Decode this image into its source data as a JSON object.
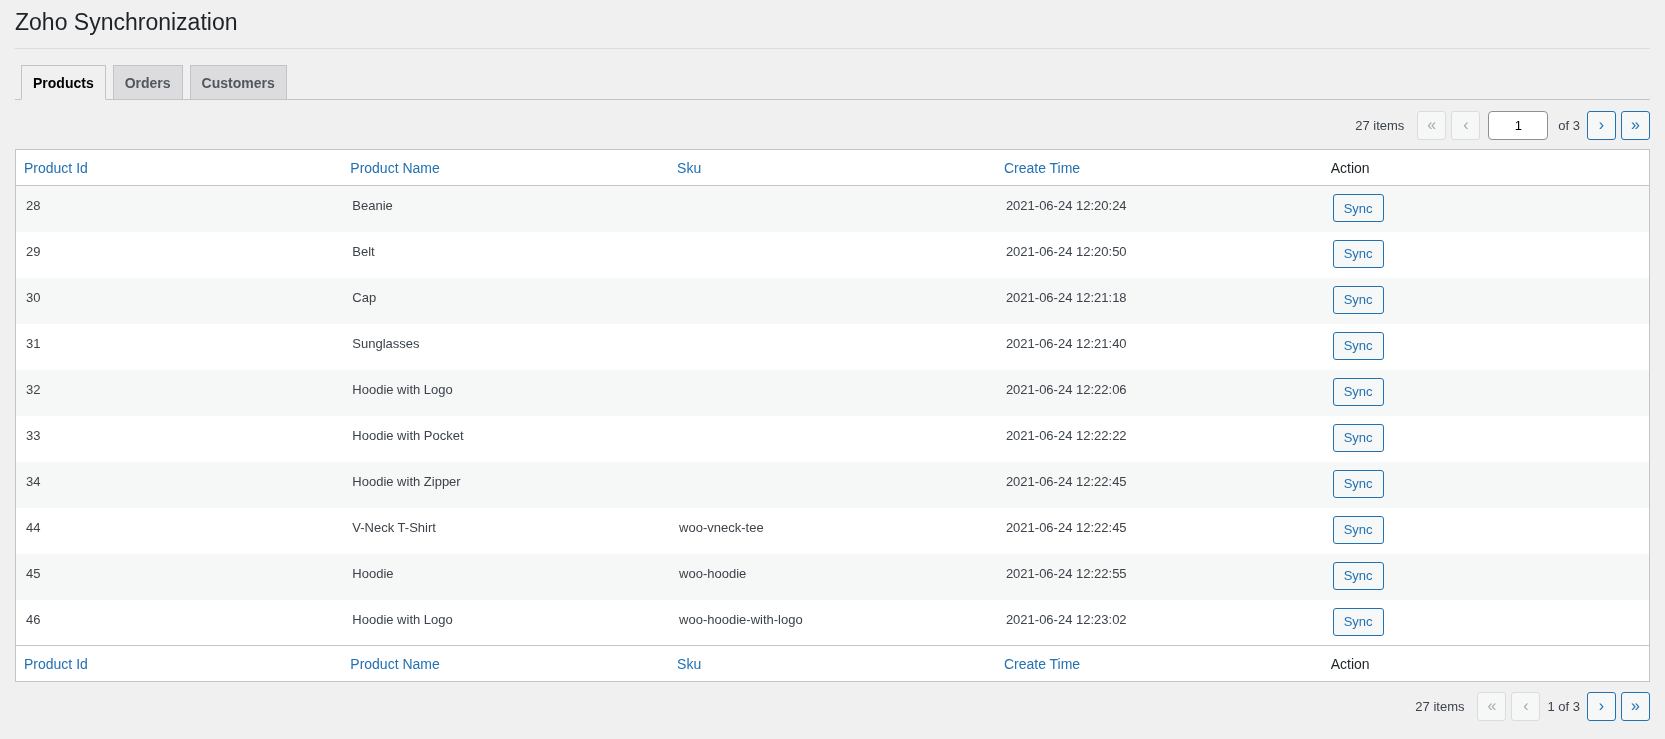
{
  "page_title": "Zoho Synchronization",
  "tabs": [
    {
      "label": "Products",
      "selected": true
    },
    {
      "label": "Orders",
      "selected": false
    },
    {
      "label": "Customers",
      "selected": false
    }
  ],
  "pagination_top": {
    "count": "27 items",
    "buttons": [
      {
        "kind": "first",
        "label": "«",
        "disabled": true
      },
      {
        "kind": "prev",
        "label": "‹",
        "disabled": true
      },
      {
        "kind": "page_input",
        "value": "1"
      },
      {
        "kind": "total",
        "label": "of 3"
      },
      {
        "kind": "next",
        "label": "›",
        "disabled": false
      },
      {
        "kind": "last",
        "label": "»",
        "disabled": false
      }
    ]
  },
  "table": {
    "columns": [
      {
        "label": "Product Id",
        "sortable": true
      },
      {
        "label": "Product Name",
        "sortable": true
      },
      {
        "label": "Sku",
        "sortable": true
      },
      {
        "label": "Create Time",
        "sortable": true
      },
      {
        "label": "Action",
        "sortable": false
      }
    ],
    "rows": [
      {
        "cells": [
          "28",
          "Beanie",
          "",
          "2021-06-24 12:20:24"
        ],
        "action": "Sync"
      },
      {
        "cells": [
          "29",
          "Belt",
          "",
          "2021-06-24 12:20:50"
        ],
        "action": "Sync"
      },
      {
        "cells": [
          "30",
          "Cap",
          "",
          "2021-06-24 12:21:18"
        ],
        "action": "Sync"
      },
      {
        "cells": [
          "31",
          "Sunglasses",
          "",
          "2021-06-24 12:21:40"
        ],
        "action": "Sync"
      },
      {
        "cells": [
          "32",
          "Hoodie with Logo",
          "",
          "2021-06-24 12:22:06"
        ],
        "action": "Sync"
      },
      {
        "cells": [
          "33",
          "Hoodie with Pocket",
          "",
          "2021-06-24 12:22:22"
        ],
        "action": "Sync"
      },
      {
        "cells": [
          "34",
          "Hoodie with Zipper",
          "",
          "2021-06-24 12:22:45"
        ],
        "action": "Sync"
      },
      {
        "cells": [
          "44",
          "V-Neck T-Shirt",
          "woo-vneck-tee",
          "2021-06-24 12:22:45"
        ],
        "action": "Sync"
      },
      {
        "cells": [
          "45",
          "Hoodie",
          "woo-hoodie",
          "2021-06-24 12:22:55"
        ],
        "action": "Sync"
      },
      {
        "cells": [
          "46",
          "Hoodie with Logo",
          "woo-hoodie-with-logo",
          "2021-06-24 12:23:02"
        ],
        "action": "Sync"
      }
    ],
    "footer_columns": [
      {
        "label": "Product Id",
        "sortable": true
      },
      {
        "label": "Product Name",
        "sortable": true
      },
      {
        "label": "Sku",
        "sortable": true
      },
      {
        "label": "Create Time",
        "sortable": true
      },
      {
        "label": "Action",
        "sortable": false
      }
    ]
  },
  "pagination_bottom": {
    "count": "27 items",
    "buttons": [
      {
        "kind": "first",
        "label": "«",
        "disabled": true
      },
      {
        "kind": "prev",
        "label": "‹",
        "disabled": true
      },
      {
        "kind": "total",
        "label": "1 of 3"
      },
      {
        "kind": "next",
        "label": "›",
        "disabled": false
      },
      {
        "kind": "last",
        "label": "»",
        "disabled": false
      }
    ]
  }
}
